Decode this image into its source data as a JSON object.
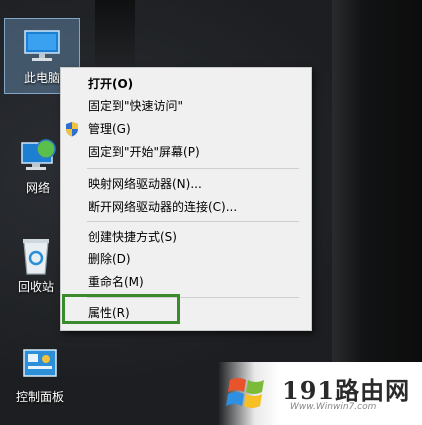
{
  "desktop": {
    "icons": [
      {
        "label": "此电脑"
      },
      {
        "label": "网络"
      },
      {
        "label": "回收站"
      },
      {
        "label": "控制面板"
      }
    ]
  },
  "context_menu": {
    "groups": [
      [
        "打开(O)",
        "固定到\"快速访问\"",
        "管理(G)",
        "固定到\"开始\"屏幕(P)"
      ],
      [
        "映射网络驱动器(N)...",
        "断开网络驱动器的连接(C)..."
      ],
      [
        "创建快捷方式(S)",
        "删除(D)",
        "重命名(M)"
      ],
      [
        "属性(R)"
      ]
    ],
    "open": "打开(O)",
    "pin_quick": "固定到\"快速访问\"",
    "manage": "管理(G)",
    "pin_start": "固定到\"开始\"屏幕(P)",
    "map_drive": "映射网络驱动器(N)...",
    "disconnect_drive": "断开网络驱动器的连接(C)...",
    "create_shortcut": "创建快捷方式(S)",
    "delete": "删除(D)",
    "rename": "重命名(M)",
    "properties": "属性(R)"
  },
  "highlight_color": "#3c8a2e",
  "watermark": {
    "text": "191路由网",
    "sub": "Www.Winwin7.com"
  }
}
